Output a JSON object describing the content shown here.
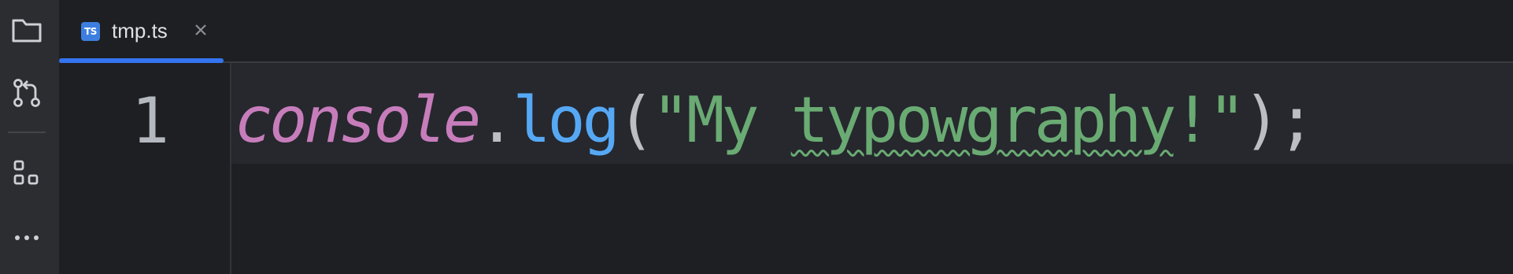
{
  "activity_bar": {
    "items": [
      {
        "icon": "folder-icon"
      },
      {
        "icon": "git-pull-request-icon"
      },
      {
        "icon": "structure-icon"
      },
      {
        "icon": "more-icon"
      }
    ]
  },
  "tab": {
    "icon_text": "TS",
    "label": "tmp.ts",
    "close_icon": "close-icon",
    "icon_color": "#3d7fe0",
    "active_indicator_color": "#3574f0"
  },
  "editor": {
    "line_number": "1",
    "tokens": {
      "keyword": "console",
      "dot": ".",
      "method": "log",
      "open_paren": "(",
      "string_open": "\"My ",
      "string_misspelled": "typowgraphy",
      "string_close": "!\"",
      "close": ");"
    },
    "colors": {
      "keyword": "#c77dbb",
      "method": "#56a8f5",
      "string": "#6aab73",
      "punctuation": "#bcbec4",
      "background": "#1e1f22"
    }
  }
}
